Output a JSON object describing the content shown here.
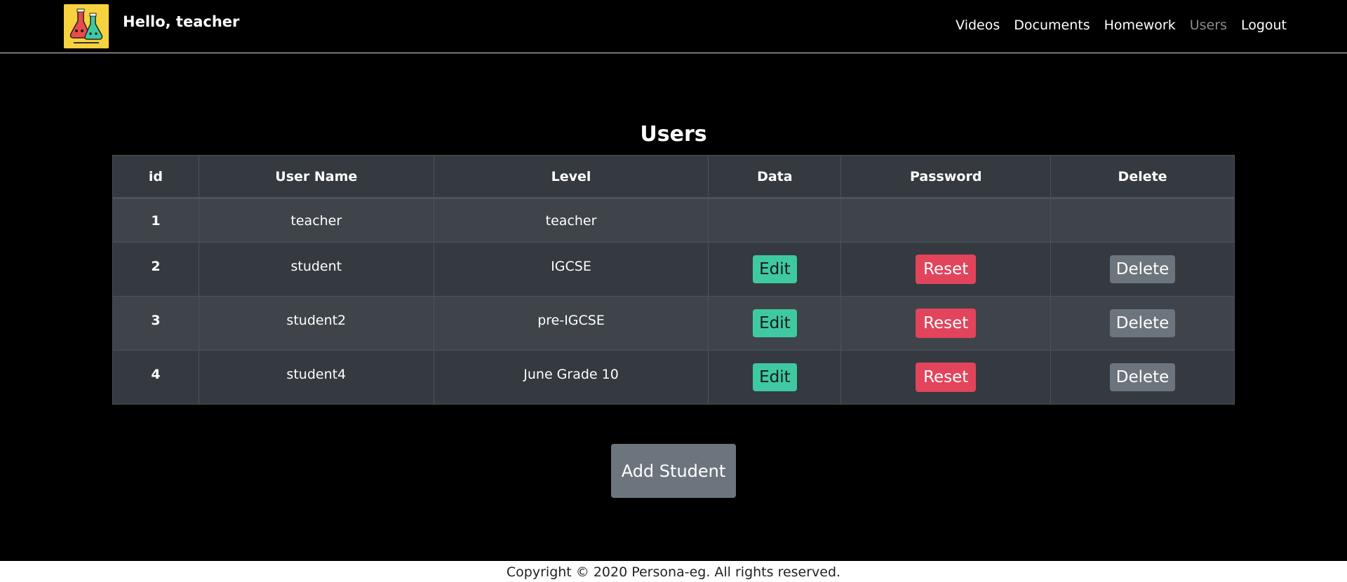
{
  "header": {
    "greeting": "Hello, teacher",
    "logo_icon": "science-flasks-logo",
    "nav": [
      {
        "label": "Videos",
        "active": false
      },
      {
        "label": "Documents",
        "active": false
      },
      {
        "label": "Homework",
        "active": false
      },
      {
        "label": "Users",
        "active": true
      },
      {
        "label": "Logout",
        "active": false
      }
    ]
  },
  "main": {
    "title": "Users",
    "table": {
      "columns": [
        "id",
        "User Name",
        "Level",
        "Data",
        "Password",
        "Delete"
      ],
      "rows": [
        {
          "id": "1",
          "user_name": "teacher",
          "level": "teacher",
          "edit": "",
          "reset": "",
          "delete": ""
        },
        {
          "id": "2",
          "user_name": "student",
          "level": "IGCSE",
          "edit": "Edit",
          "reset": "Reset",
          "delete": "Delete"
        },
        {
          "id": "3",
          "user_name": "student2",
          "level": "pre-IGCSE",
          "edit": "Edit",
          "reset": "Reset",
          "delete": "Delete"
        },
        {
          "id": "4",
          "user_name": "student4",
          "level": "June Grade 10",
          "edit": "Edit",
          "reset": "Reset",
          "delete": "Delete"
        }
      ]
    },
    "add_student_label": "Add Student"
  },
  "footer": {
    "copyright": "Copyright © 2020 Persona-eg. All rights reserved."
  },
  "colors": {
    "edit": "#3fc9a3",
    "reset": "#e2445c",
    "delete": "#6c757d",
    "table_header": "#343a40",
    "logo_bg": "#f7d23e"
  }
}
